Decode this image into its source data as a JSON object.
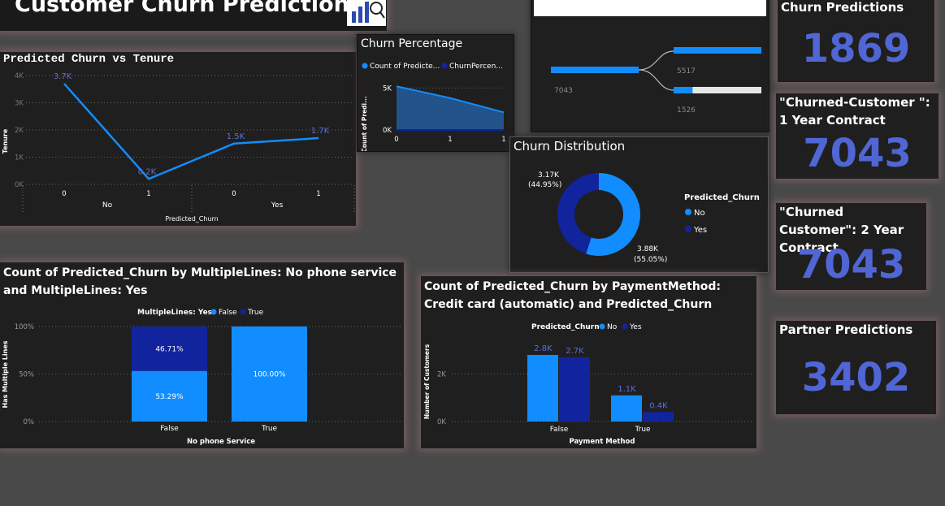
{
  "header": {
    "title": "Customer Churn Prediction",
    "icon": "chart-report-icon"
  },
  "colors": {
    "light": "#118dff",
    "dark": "#12239e",
    "kpi": "#4f66d4",
    "card": "#201f1f"
  },
  "tenure_chart": {
    "title": "Predicted Churn vs Tenure",
    "yticks": [
      "4K",
      "3K",
      "2K",
      "1K",
      "0K"
    ],
    "xlabels": [
      "0",
      "1",
      "0",
      "1"
    ],
    "groups": [
      "No",
      "Yes"
    ],
    "point_labels": [
      "3.7K",
      "0.2K",
      "1.5K",
      "1.7K"
    ],
    "xlabel": "Predicted_Churn",
    "ylabel": "Tenure"
  },
  "pct_chart": {
    "title": "Churn Percentage",
    "legend": [
      "Count of Predicte...",
      "ChurnPercen..."
    ],
    "yticks": [
      "5K",
      "0K"
    ],
    "xticks": [
      "0",
      "1",
      "1"
    ],
    "ylabel": "Count of Predi..."
  },
  "tree_chart": {
    "values": [
      "7043",
      "5517",
      "1526"
    ]
  },
  "donut_chart": {
    "title": "Churn Distribution",
    "legend_title": "Predicted_Churn",
    "legend": [
      "No",
      "Yes"
    ],
    "label_yes": "3.17K",
    "label_yes_pct": "(44.95%)",
    "label_no": "3.88K",
    "label_no_pct": "(55.05%)"
  },
  "lines_chart": {
    "title": "Count of Predicted_Churn by MultipleLines: No phone service and MultipleLines: Yes",
    "legend_title": "MultipleLines: Yes",
    "legend": [
      "False",
      "True"
    ],
    "yticks": [
      "100%",
      "50%",
      "0%"
    ],
    "categories": [
      "False",
      "True"
    ],
    "seg_labels": [
      "46.71%",
      "53.29%",
      "100.00%"
    ],
    "xlabel": "No phone Service",
    "ylabel": "Has Multiple Lines"
  },
  "pay_chart": {
    "title": "Count of Predicted_Churn by PaymentMethod: Credit card (automatic) and Predicted_Churn",
    "legend_title": "Predicted_Churn",
    "legend": [
      "No",
      "Yes"
    ],
    "yticks": [
      "2K",
      "0K"
    ],
    "categories": [
      "False",
      "True"
    ],
    "bar_labels": [
      "2.8K",
      "2.7K",
      "1.1K",
      "0.4K"
    ],
    "xlabel": "Payment Method",
    "ylabel": "Number of Customers"
  },
  "kpis": [
    {
      "label": "Churn Predictions",
      "value": "1869"
    },
    {
      "label": "\"Churned-Customer \": 1 Year Contract",
      "value": "7043"
    },
    {
      "label": "\"Churned Customer\": 2 Year Contract",
      "value": "7043"
    },
    {
      "label": "Partner Predictions",
      "value": "3402"
    }
  ],
  "chart_data": [
    {
      "type": "line",
      "title": "Predicted Churn vs Tenure",
      "xlabel": "Predicted_Churn",
      "ylabel": "Tenure",
      "categories": [
        "No / 0",
        "No / 1",
        "Yes / 0",
        "Yes / 1"
      ],
      "values": [
        3700,
        200,
        1500,
        1700
      ],
      "ylim": [
        0,
        4000
      ]
    },
    {
      "type": "area",
      "title": "Churn Percentage",
      "x": [
        "0",
        "1",
        "1"
      ],
      "series": [
        {
          "name": "Count of Predicte...",
          "values": [
            5200,
            3800,
            2100
          ]
        }
      ],
      "ylim": [
        0,
        6000
      ]
    },
    {
      "type": "pie",
      "title": "Churn Distribution",
      "categories": [
        "No",
        "Yes"
      ],
      "values": [
        3880,
        3170
      ],
      "percent": [
        55.05,
        44.95
      ]
    },
    {
      "type": "bar",
      "title": "Count of Predicted_Churn by MultipleLines: No phone service and MultipleLines: Yes",
      "xlabel": "No phone Service",
      "ylabel": "Has Multiple Lines",
      "categories": [
        "False",
        "True"
      ],
      "series": [
        {
          "name": "False",
          "values": [
            53.29,
            100.0
          ]
        },
        {
          "name": "True",
          "values": [
            46.71,
            0
          ]
        }
      ],
      "ylim": [
        0,
        100
      ]
    },
    {
      "type": "bar",
      "title": "Count of Predicted_Churn by PaymentMethod: Credit card (automatic) and Predicted_Churn",
      "xlabel": "Payment Method",
      "ylabel": "Number of Customers",
      "categories": [
        "False",
        "True"
      ],
      "series": [
        {
          "name": "No",
          "values": [
            2800,
            1100
          ]
        },
        {
          "name": "Yes",
          "values": [
            2700,
            400
          ]
        }
      ]
    }
  ]
}
